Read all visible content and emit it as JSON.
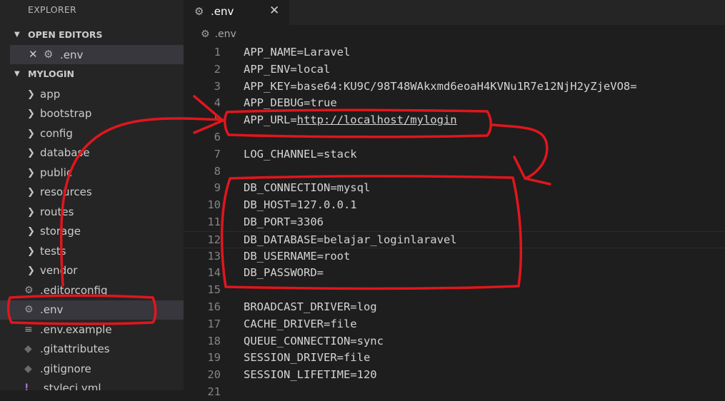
{
  "sidebar": {
    "title": "EXPLORER",
    "open_editors": {
      "header": "OPEN EDITORS",
      "items": [
        {
          "name": ".env"
        }
      ]
    },
    "project": {
      "header": "MYLOGIN",
      "folders": [
        {
          "name": "app"
        },
        {
          "name": "bootstrap"
        },
        {
          "name": "config"
        },
        {
          "name": "database"
        },
        {
          "name": "public"
        },
        {
          "name": "resources"
        },
        {
          "name": "routes"
        },
        {
          "name": "storage"
        },
        {
          "name": "tests"
        },
        {
          "name": "vendor"
        }
      ],
      "files": [
        {
          "name": ".editorconfig",
          "icon": "gear-icon"
        },
        {
          "name": ".env",
          "icon": "gear-icon"
        },
        {
          "name": ".env.example",
          "icon": "lines-icon"
        },
        {
          "name": ".gitattributes",
          "icon": "git-diamond-icon"
        },
        {
          "name": ".gitignore",
          "icon": "git-diamond-icon"
        },
        {
          "name": ".styleci.yml",
          "icon": "yaml-icon"
        }
      ]
    }
  },
  "tab": {
    "name": ".env"
  },
  "breadcrumb": {
    "name": ".env"
  },
  "editor": {
    "lines": [
      {
        "n": "1",
        "text": "APP_NAME=Laravel"
      },
      {
        "n": "2",
        "text": "APP_ENV=local"
      },
      {
        "n": "3",
        "text": "APP_KEY=base64:KU9C/98T48WAkxmd6eoaH4KVNu1R7e12NjH2yZjeVO8="
      },
      {
        "n": "4",
        "text": "APP_DEBUG=true"
      },
      {
        "n": "5",
        "prefix": "APP_URL=",
        "link": "http://localhost/mylogin"
      },
      {
        "n": "6",
        "text": ""
      },
      {
        "n": "7",
        "text": "LOG_CHANNEL=stack"
      },
      {
        "n": "8",
        "text": ""
      },
      {
        "n": "9",
        "text": "DB_CONNECTION=mysql"
      },
      {
        "n": "10",
        "text": "DB_HOST=127.0.0.1"
      },
      {
        "n": "11",
        "text": "DB_PORT=3306"
      },
      {
        "n": "12",
        "text": "DB_DATABASE=belajar_loginlaravel"
      },
      {
        "n": "13",
        "text": "DB_USERNAME=root"
      },
      {
        "n": "14",
        "text": "DB_PASSWORD="
      },
      {
        "n": "15",
        "text": ""
      },
      {
        "n": "16",
        "text": "BROADCAST_DRIVER=log"
      },
      {
        "n": "17",
        "text": "CACHE_DRIVER=file"
      },
      {
        "n": "18",
        "text": "QUEUE_CONNECTION=sync"
      },
      {
        "n": "19",
        "text": "SESSION_DRIVER=file"
      },
      {
        "n": "20",
        "text": "SESSION_LIFETIME=120"
      },
      {
        "n": "21",
        "text": ""
      }
    ]
  },
  "colors": {
    "annotation": "#e0161d",
    "sidebar_bg": "#252526",
    "editor_bg": "#1e1e1e"
  }
}
